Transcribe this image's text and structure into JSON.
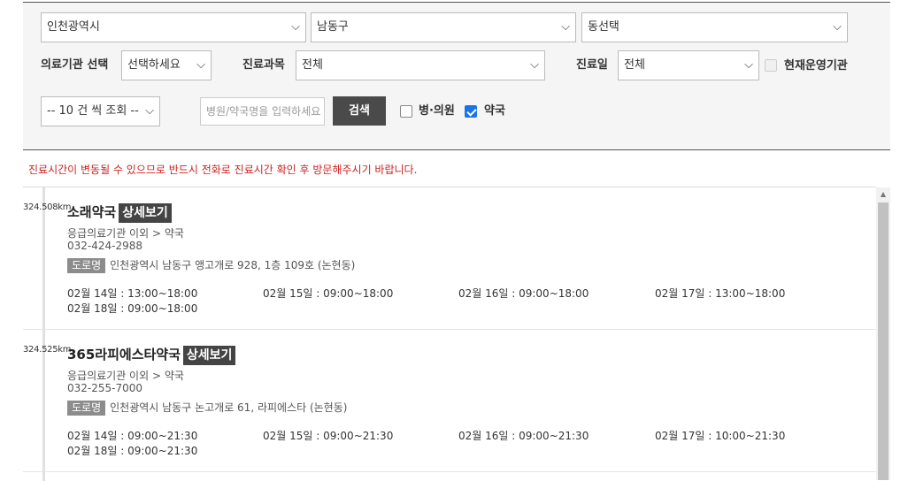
{
  "filters": {
    "region": "인천광역시",
    "district": "남동구",
    "dong": "동선택",
    "facility_label": "의료기관 선택",
    "facility_value": "선택하세요",
    "dept_label": "진료과목",
    "dept_value": "전체",
    "day_label": "진료일",
    "day_value": "전체",
    "open_now_label": "현재운영기관",
    "count_value": "-- 10 건 씩 조회 --",
    "search_placeholder": "병원/약국명을 입력하세요",
    "search_button": "검색",
    "hospital_label": "병·의원",
    "hospital_checked": false,
    "pharmacy_label": "약국",
    "pharmacy_checked": true
  },
  "notice": "진료시간이 변동될 수 있으므로 반드시 전화로 진료시간 확인 후 방문해주시기 바랍니다.",
  "results": [
    {
      "distance": "324.508km",
      "name": "소래약국",
      "detail": "상세보기",
      "category": "응급의료기관 이외 > 약국",
      "phone": "032-424-2988",
      "road_badge": "도로명",
      "address": "인천광역시 남동구 앵고개로 928, 1층 109호 (논현동)",
      "hours": [
        "02월 14일 : 13:00~18:00",
        "02월 15일 : 09:00~18:00",
        "02월 16일 : 09:00~18:00",
        "02월 17일 : 13:00~18:00",
        "02월 18일 : 09:00~18:00"
      ]
    },
    {
      "distance": "324.525km",
      "name": "365라피에스타약국",
      "detail": "상세보기",
      "category": "응급의료기관 이외 > 약국",
      "phone": "032-255-7000",
      "road_badge": "도로명",
      "address": "인천광역시 남동구 논고개로 61, 라피에스타 (논현동)",
      "hours": [
        "02월 14일 : 09:00~21:30",
        "02월 15일 : 09:00~21:30",
        "02월 16일 : 09:00~21:30",
        "02월 17일 : 10:00~21:30",
        "02월 18일 : 09:00~21:30"
      ]
    }
  ],
  "icons": {
    "chevron": "chevron-down-icon",
    "scroll_up": "scroll-up-arrow-icon"
  },
  "colors": {
    "notice_red": "#cc2222",
    "button_dark": "#4a4a4a",
    "checkbox_blue": "#1a73e8"
  }
}
